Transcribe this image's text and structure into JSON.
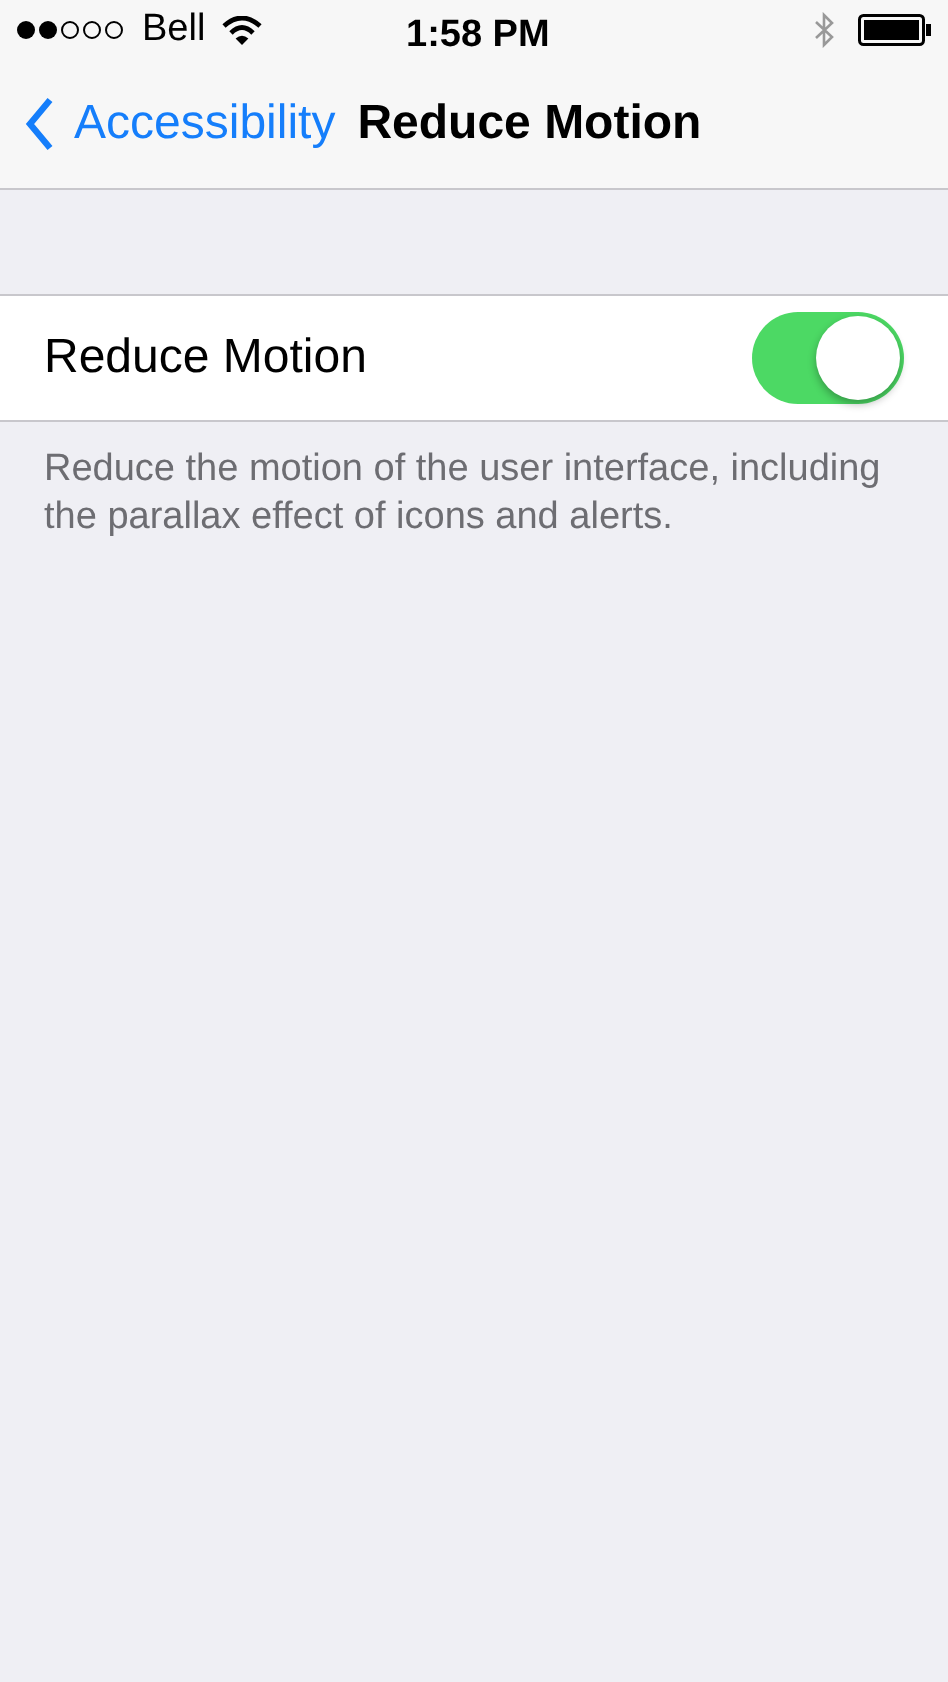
{
  "status_bar": {
    "carrier": "Bell",
    "time": "1:58 PM"
  },
  "nav_bar": {
    "back_label": "Accessibility",
    "title": "Reduce Motion"
  },
  "settings": [
    {
      "label": "Reduce Motion",
      "on": true
    }
  ],
  "footer": "Reduce the motion of the user interface, including the parallax effect of icons and alerts."
}
